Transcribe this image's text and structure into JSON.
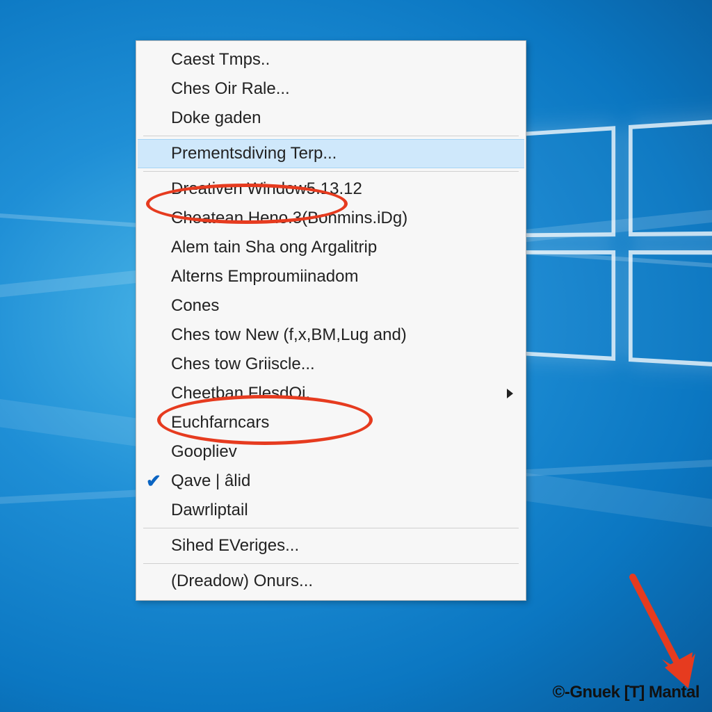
{
  "context_menu": {
    "groups": [
      {
        "items": [
          {
            "label": "Caest Tmps..",
            "highlighted": false,
            "checked": false,
            "submenu": false
          },
          {
            "label": "Ches Oir Rale...",
            "highlighted": false,
            "checked": false,
            "submenu": false
          },
          {
            "label": "Doke gaden",
            "highlighted": false,
            "checked": false,
            "submenu": false
          }
        ]
      },
      {
        "items": [
          {
            "label": "Prementsdiving Terp...",
            "highlighted": true,
            "checked": false,
            "submenu": false
          }
        ]
      },
      {
        "items": [
          {
            "label": "Dreativen Window5.13.12",
            "highlighted": false,
            "checked": false,
            "submenu": false
          },
          {
            "label": "Cheatean Heno.3(Bonmins.iDg)",
            "highlighted": false,
            "checked": false,
            "submenu": false
          },
          {
            "label": "Alem tain Sha ong Argalitrip",
            "highlighted": false,
            "checked": false,
            "submenu": false
          },
          {
            "label": "Alterns Emproumiinadom",
            "highlighted": false,
            "checked": false,
            "submenu": false
          },
          {
            "label": "Cones",
            "highlighted": false,
            "checked": false,
            "submenu": false
          },
          {
            "label": "Ches tow New (f,x,BM,Lug and)",
            "highlighted": false,
            "checked": false,
            "submenu": false
          },
          {
            "label": "Ches tow Griiscle...",
            "highlighted": false,
            "checked": false,
            "submenu": false
          },
          {
            "label": "Cheetban FlesdOi.",
            "highlighted": false,
            "checked": false,
            "submenu": true
          },
          {
            "label": "Euchfarncars",
            "highlighted": false,
            "checked": false,
            "submenu": false
          },
          {
            "label": "Goopliev",
            "highlighted": false,
            "checked": false,
            "submenu": false
          },
          {
            "label": "Qave | âlid",
            "highlighted": false,
            "checked": true,
            "submenu": false
          },
          {
            "label": "Dawrliptail",
            "highlighted": false,
            "checked": false,
            "submenu": false
          }
        ]
      },
      {
        "items": [
          {
            "label": "Sihed EVeriges...",
            "highlighted": false,
            "checked": false,
            "submenu": false
          }
        ]
      },
      {
        "items": [
          {
            "label": "(Dreadow) Onurs...",
            "highlighted": false,
            "checked": false,
            "submenu": false
          }
        ]
      }
    ]
  },
  "annotations": {
    "ellipse1": {
      "target": "Dreativen Window5.13.12"
    },
    "ellipse2": {
      "target": "Cheetban FlesdOi. / Euchfarncars"
    },
    "arrow": {
      "points_to": "watermark"
    }
  },
  "watermark": "©-Gnuek [T] Mantal",
  "colors": {
    "annotation_red": "#e63b1f",
    "menu_highlight": "#cfe8fb",
    "check_blue": "#0a64c2"
  }
}
